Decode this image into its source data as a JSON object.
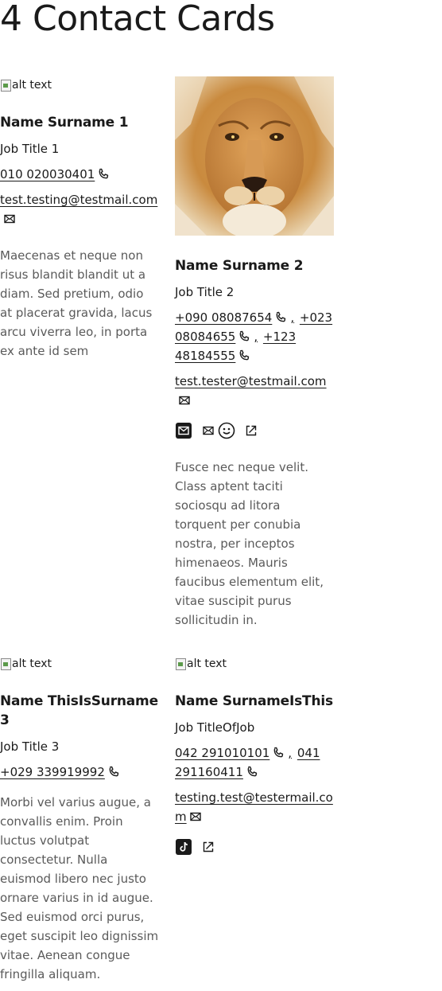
{
  "page": {
    "title": "4 Contact Cards"
  },
  "cards": [
    {
      "image_alt": "alt text",
      "name": "Name Surname 1",
      "job_title": "Job Title 1",
      "phones": [
        "010 020030401"
      ],
      "email": "test.testing@testmail.com",
      "bio": "Maecenas et neque non risus blandit blandit ut a diam. Sed pretium, odio at placerat gravida, lacus arcu viverra leo, in porta ex ante id sem"
    },
    {
      "image_alt": "lion photo",
      "name": "Name Surname 2",
      "job_title": "Job Title 2",
      "phones": [
        "+090 08087654",
        "+023 08084655",
        "+123 48184555"
      ],
      "phone_separator": ",",
      "email": "test.tester@testmail.com",
      "socials": [
        "email-square-icon",
        "mail-icon",
        "smiley-icon",
        "external-link-icon"
      ],
      "bio": "Fusce nec neque velit. Class aptent taciti sociosqu ad litora torquent per conubia nostra, per inceptos himenaeos. Mauris faucibus elementum elit, vitae suscipit purus sollicitudin in."
    },
    {
      "image_alt": "alt text",
      "name": "Name ThisIsSurname 3",
      "job_title": "Job Title 3",
      "phones": [
        "+029 339919992"
      ],
      "bio": "Morbi vel varius augue, a convallis enim. Proin luctus volutpat consectetur. Nulla euismod libero nec justo ornare varius in id augue. Sed euismod orci purus, eget suscipit leo dignissim vitae. Aenean congue fringilla aliquam."
    },
    {
      "image_alt": "alt text",
      "name": "Name SurnameIsThis",
      "job_title": "Job TitleOfJob",
      "phones": [
        "042 291010101",
        "041 291160411"
      ],
      "phone_separator": ",",
      "email": "testing.test@testermail.com",
      "socials": [
        "tiktok-icon",
        "external-link-icon"
      ]
    }
  ]
}
